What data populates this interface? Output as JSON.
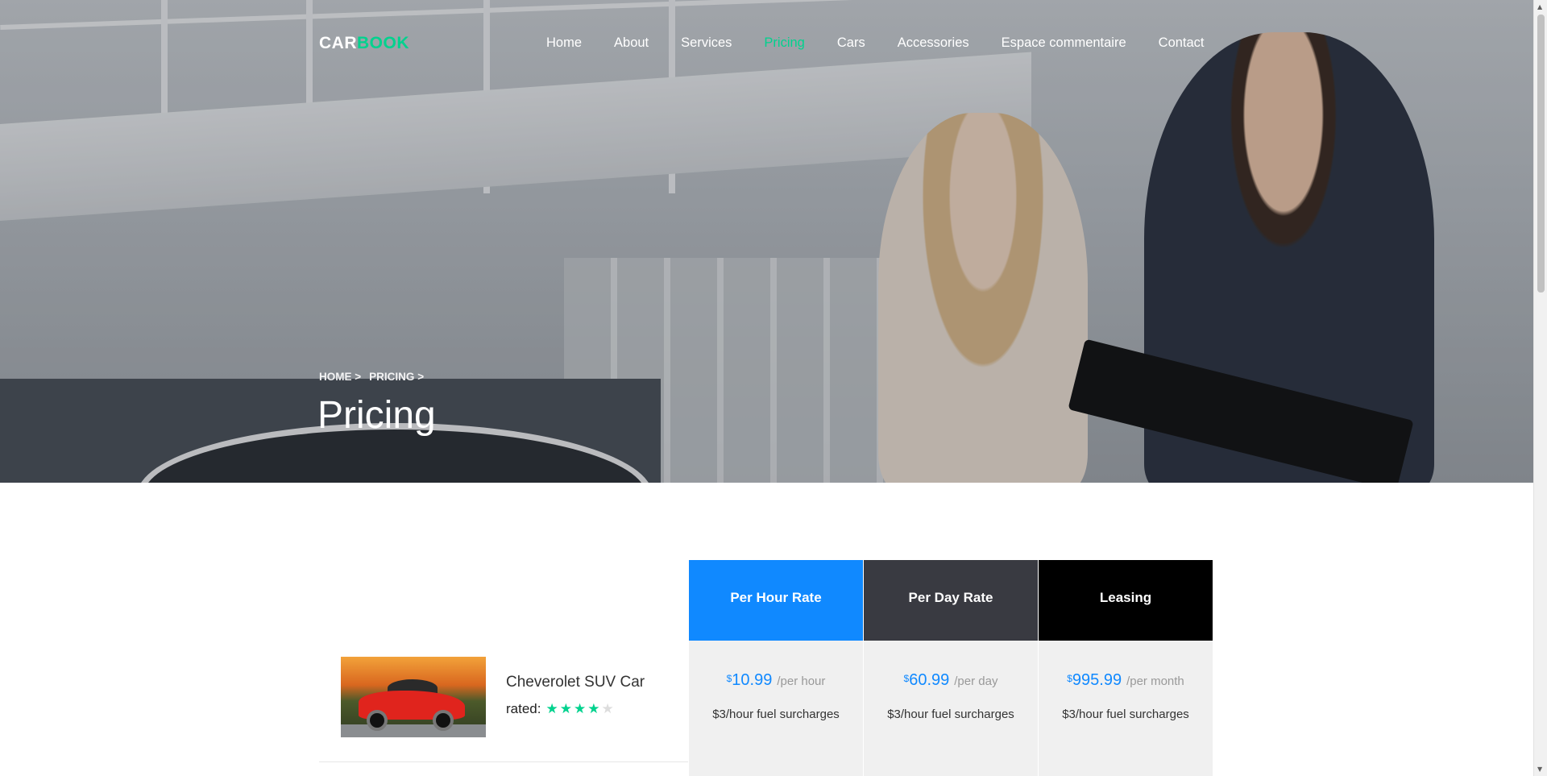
{
  "brand": {
    "part1": "CAR",
    "part2": "BOOK"
  },
  "nav": {
    "items": [
      {
        "label": "Home"
      },
      {
        "label": "About"
      },
      {
        "label": "Services"
      },
      {
        "label": "Pricing",
        "active": true
      },
      {
        "label": "Cars"
      },
      {
        "label": "Accessories"
      },
      {
        "label": "Espace commentaire"
      },
      {
        "label": "Contact"
      }
    ]
  },
  "hero": {
    "breadcrumb": [
      {
        "label": "HOME"
      },
      {
        "label": "PRICING"
      }
    ],
    "breadcrumb_sep": ">",
    "title": "Pricing"
  },
  "pricing": {
    "columns": [
      {
        "title": "Per Hour Rate",
        "color": "#1089ff"
      },
      {
        "title": "Per Day Rate",
        "color": "#393a41"
      },
      {
        "title": "Leasing",
        "color": "#000000"
      }
    ],
    "rows": [
      {
        "car": "Cheverolet SUV Car",
        "rated_label": "rated:",
        "rating": 4,
        "rating_max": 5,
        "prices": [
          {
            "currency": "$",
            "amount": "10.99",
            "period": "/per hour",
            "note": "$3/hour fuel surcharges"
          },
          {
            "currency": "$",
            "amount": "60.99",
            "period": "/per day",
            "note": "$3/hour fuel surcharges"
          },
          {
            "currency": "$",
            "amount": "995.99",
            "period": "/per month",
            "note": "$3/hour fuel surcharges"
          }
        ]
      }
    ]
  },
  "colors": {
    "accent": "#01d28e",
    "primary": "#1089ff"
  }
}
